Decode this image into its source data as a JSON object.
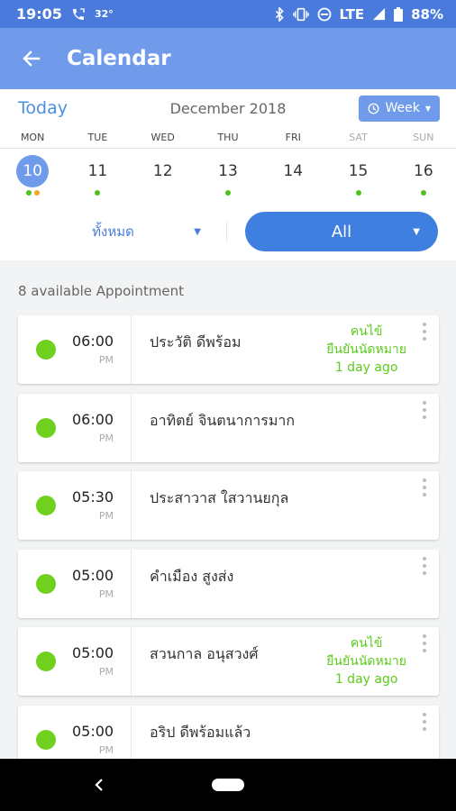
{
  "status_bar": {
    "time": "19:05",
    "temperature": "32°",
    "network": "LTE",
    "battery": "88%"
  },
  "app_bar": {
    "title": "Calendar"
  },
  "calendar": {
    "today_label": "Today",
    "month_label": "December 2018",
    "view_label": "Week",
    "weekdays": [
      "MON",
      "TUE",
      "WED",
      "THU",
      "FRI",
      "SAT",
      "SUN"
    ],
    "days": [
      {
        "num": "10",
        "selected": true,
        "dots": [
          "green",
          "orange"
        ]
      },
      {
        "num": "11",
        "selected": false,
        "dots": [
          "green"
        ]
      },
      {
        "num": "12",
        "selected": false,
        "dots": []
      },
      {
        "num": "13",
        "selected": false,
        "dots": [
          "green"
        ]
      },
      {
        "num": "14",
        "selected": false,
        "dots": []
      },
      {
        "num": "15",
        "selected": false,
        "dots": [
          "green"
        ]
      },
      {
        "num": "16",
        "selected": false,
        "dots": [
          "green"
        ]
      }
    ]
  },
  "filters": {
    "category_label": "ทั้งหมด",
    "status_label": "All"
  },
  "appointments": {
    "count_label": "8 available Appointment",
    "items": [
      {
        "time": "06:00",
        "ampm": "PM",
        "name": "ประวัติ ดีพร้อม",
        "info": [
          "คนไข้",
          "ยืนยันนัดหมาย",
          "1 day ago"
        ]
      },
      {
        "time": "06:00",
        "ampm": "PM",
        "name": "อาทิตย์ จินตนาการมาก",
        "info": []
      },
      {
        "time": "05:30",
        "ampm": "PM",
        "name": "ประสาวาส ใสวานยกุล",
        "info": []
      },
      {
        "time": "05:00",
        "ampm": "PM",
        "name": "คำเมือง สูงส่ง",
        "info": []
      },
      {
        "time": "05:00",
        "ampm": "PM",
        "name": "สวนกาล อนุสวงศ์",
        "info": [
          "คนไข้",
          "ยืนยันนัดหมาย",
          "1 day ago"
        ]
      },
      {
        "time": "05:00",
        "ampm": "PM",
        "name": "อริป ดีพร้อมแล้ว",
        "info": []
      }
    ]
  },
  "colors": {
    "status_bar": "#4a7bdc",
    "app_bar": "#6f9bea",
    "accent": "#3f7fe0",
    "appointment_dot": "#6fd11d",
    "confirmed_text": "#5ccb1c",
    "orange_dot": "#f5a623"
  }
}
